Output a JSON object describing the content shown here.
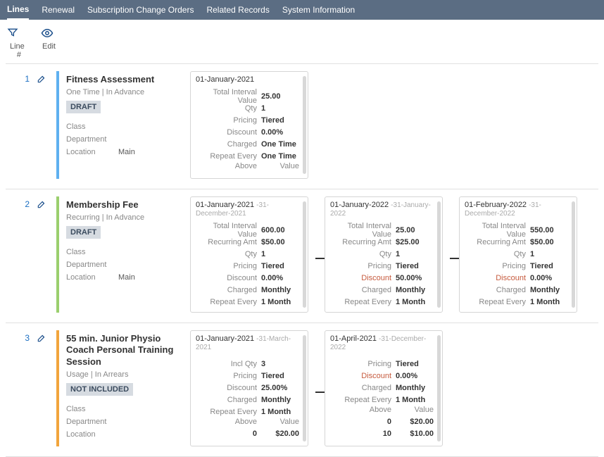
{
  "tabs": [
    "Lines",
    "Renewal",
    "Subscription Change Orders",
    "Related Records",
    "System Information"
  ],
  "activeTab": 0,
  "headers": {
    "line": "Line #",
    "edit": "Edit"
  },
  "lines": [
    {
      "num": "1",
      "title": "Fitness Assessment",
      "subtitle": "One Time | In Advance",
      "badge": "DRAFT",
      "color": "blue",
      "fields": {
        "class_l": "Class",
        "class_v": "",
        "dept_l": "Department",
        "dept_v": "",
        "loc_l": "Location",
        "loc_v": "Main"
      },
      "cards": [
        {
          "start": "01-January-2021",
          "end": "",
          "rows": [
            {
              "l": "Total Interval Value",
              "v": "25.00"
            },
            {
              "l": "Qty",
              "v": "1"
            },
            {
              "l": "Pricing",
              "v": "Tiered"
            },
            {
              "l": "Discount",
              "v": "0.00%"
            },
            {
              "l": "Charged",
              "v": "One Time"
            },
            {
              "l": "Repeat Every",
              "v": "One Time"
            }
          ],
          "subhead": {
            "a": "Above",
            "b": "Value"
          }
        }
      ]
    },
    {
      "num": "2",
      "title": "Membership Fee",
      "subtitle": "Recurring | In Advance",
      "badge": "DRAFT",
      "color": "green",
      "fields": {
        "class_l": "Class",
        "class_v": "",
        "dept_l": "Department",
        "dept_v": "",
        "loc_l": "Location",
        "loc_v": "Main"
      },
      "cards": [
        {
          "start": "01-January-2021",
          "end": "-31-December-2021",
          "rows": [
            {
              "l": "Total Interval Value",
              "v": "600.00"
            },
            {
              "l": "Recurring Amt",
              "v": "$50.00"
            },
            {
              "l": "Qty",
              "v": "1"
            },
            {
              "l": "Pricing",
              "v": "Tiered"
            },
            {
              "l": "Discount",
              "v": "0.00%"
            },
            {
              "l": "Charged",
              "v": "Monthly"
            },
            {
              "l": "Repeat Every",
              "v": "1 Month"
            }
          ]
        },
        {
          "start": "01-January-2022",
          "end": "-31-January-2022",
          "rows": [
            {
              "l": "Total Interval Value",
              "v": "25.00"
            },
            {
              "l": "Recurring Amt",
              "v": "$25.00"
            },
            {
              "l": "Qty",
              "v": "1"
            },
            {
              "l": "Pricing",
              "v": "Tiered"
            },
            {
              "l": "Discount",
              "v": "50.00%",
              "red": true
            },
            {
              "l": "Charged",
              "v": "Monthly"
            },
            {
              "l": "Repeat Every",
              "v": "1 Month"
            }
          ]
        },
        {
          "start": "01-February-2022",
          "end": "-31-December-2022",
          "rows": [
            {
              "l": "Total Interval Value",
              "v": "550.00"
            },
            {
              "l": "Recurring Amt",
              "v": "$50.00"
            },
            {
              "l": "Qty",
              "v": "1"
            },
            {
              "l": "Pricing",
              "v": "Tiered"
            },
            {
              "l": "Discount",
              "v": "0.00%",
              "red": true
            },
            {
              "l": "Charged",
              "v": "Monthly"
            },
            {
              "l": "Repeat Every",
              "v": "1 Month"
            }
          ]
        }
      ]
    },
    {
      "num": "3",
      "title": "55 min. Junior Physio Coach Personal Training Session",
      "subtitle": "Usage | In Arrears",
      "badge": "NOT INCLUDED",
      "color": "orange",
      "fields": {
        "class_l": "Class",
        "class_v": "",
        "dept_l": "Department",
        "dept_v": "",
        "loc_l": "Location",
        "loc_v": ""
      },
      "cards": [
        {
          "start": "01-January-2021",
          "end": "-31-March-2021",
          "rows": [
            {
              "l": "Incl Qty",
              "v": "3"
            },
            {
              "l": "Pricing",
              "v": "Tiered"
            },
            {
              "l": "Discount",
              "v": "25.00%"
            },
            {
              "l": "Charged",
              "v": "Monthly"
            },
            {
              "l": "Repeat Every",
              "v": "1 Month"
            }
          ],
          "subhead": {
            "a": "Above",
            "b": "Value"
          },
          "dataRows": [
            {
              "a": "0",
              "b": "$20.00"
            }
          ]
        },
        {
          "start": "01-April-2021",
          "end": "-31-December-2022",
          "rows": [
            {
              "l": "Pricing",
              "v": "Tiered"
            },
            {
              "l": "Discount",
              "v": "0.00%",
              "red": true
            },
            {
              "l": "Charged",
              "v": "Monthly"
            },
            {
              "l": "Repeat Every",
              "v": "1 Month"
            }
          ],
          "subhead": {
            "a": "Above",
            "b": "Value"
          },
          "dataRows": [
            {
              "a": "0",
              "b": "$20.00"
            },
            {
              "a": "10",
              "b": "$10.00"
            }
          ]
        }
      ]
    }
  ]
}
